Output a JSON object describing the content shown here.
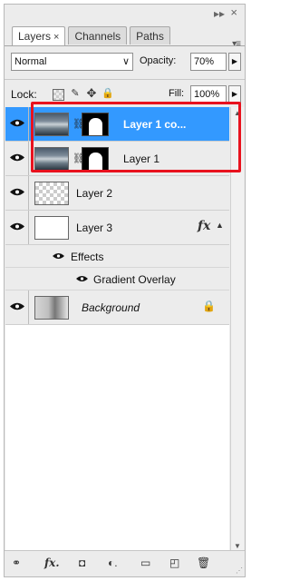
{
  "panel": {
    "tabs": [
      {
        "label": "Layers",
        "active": true,
        "close": "×"
      },
      {
        "label": "Channels",
        "active": false
      },
      {
        "label": "Paths",
        "active": false
      }
    ],
    "blend_mode": "Normal",
    "opacity_label": "Opacity:",
    "opacity_value": "70%",
    "lock_label": "Lock:",
    "fill_label": "Fill:",
    "fill_value": "100%"
  },
  "layers": [
    {
      "name": "Layer 1 co...",
      "selected": true,
      "thumbnail": "photo",
      "has_mask": true,
      "visible": true
    },
    {
      "name": "Layer 1",
      "selected": true,
      "thumbnail": "photo",
      "has_mask": true,
      "visible": true
    },
    {
      "name": "Layer 2",
      "selected": false,
      "thumbnail": "transparent",
      "visible": true
    },
    {
      "name": "Layer 3",
      "selected": false,
      "thumbnail": "white",
      "visible": true,
      "fx": "fx"
    },
    {
      "name": "Background",
      "selected": false,
      "thumbnail": "background",
      "visible": true,
      "locked": true
    }
  ],
  "effects": {
    "label": "Effects",
    "items": [
      "Gradient Overlay"
    ]
  },
  "colors": {
    "selection": "#3399ff",
    "highlight_box": "#e8121e",
    "panel_bg": "#ececec"
  },
  "bottom_icons": [
    "link-icon",
    "fx-icon",
    "add-mask-icon",
    "adjustment-layer-icon",
    "new-group-icon",
    "new-layer-icon",
    "trash-icon"
  ],
  "bottom_labels": {
    "link": "⚭",
    "fx": "fx.",
    "mask": "◘",
    "adjust": "◐.",
    "group": "▭",
    "newlayer": "◰",
    "trash": "🗑"
  }
}
